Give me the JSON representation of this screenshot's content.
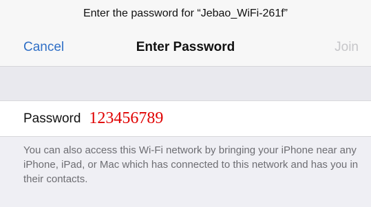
{
  "prompt": {
    "text": "Enter the password for “Jebao_WiFi-261f”"
  },
  "nav": {
    "cancel_label": "Cancel",
    "title": "Enter Password",
    "join_label": "Join"
  },
  "password_field": {
    "label": "Password",
    "value": "123456789"
  },
  "info": {
    "text": "You can also access this Wi-Fi network by bringing your iPhone near any iPhone, iPad, or Mac which has connected to this network and has you in their contacts."
  },
  "colors": {
    "accent": "#2f6fc6",
    "disabled": "#c6c6c9",
    "password_value": "#e00000",
    "background": "#efeff4"
  }
}
